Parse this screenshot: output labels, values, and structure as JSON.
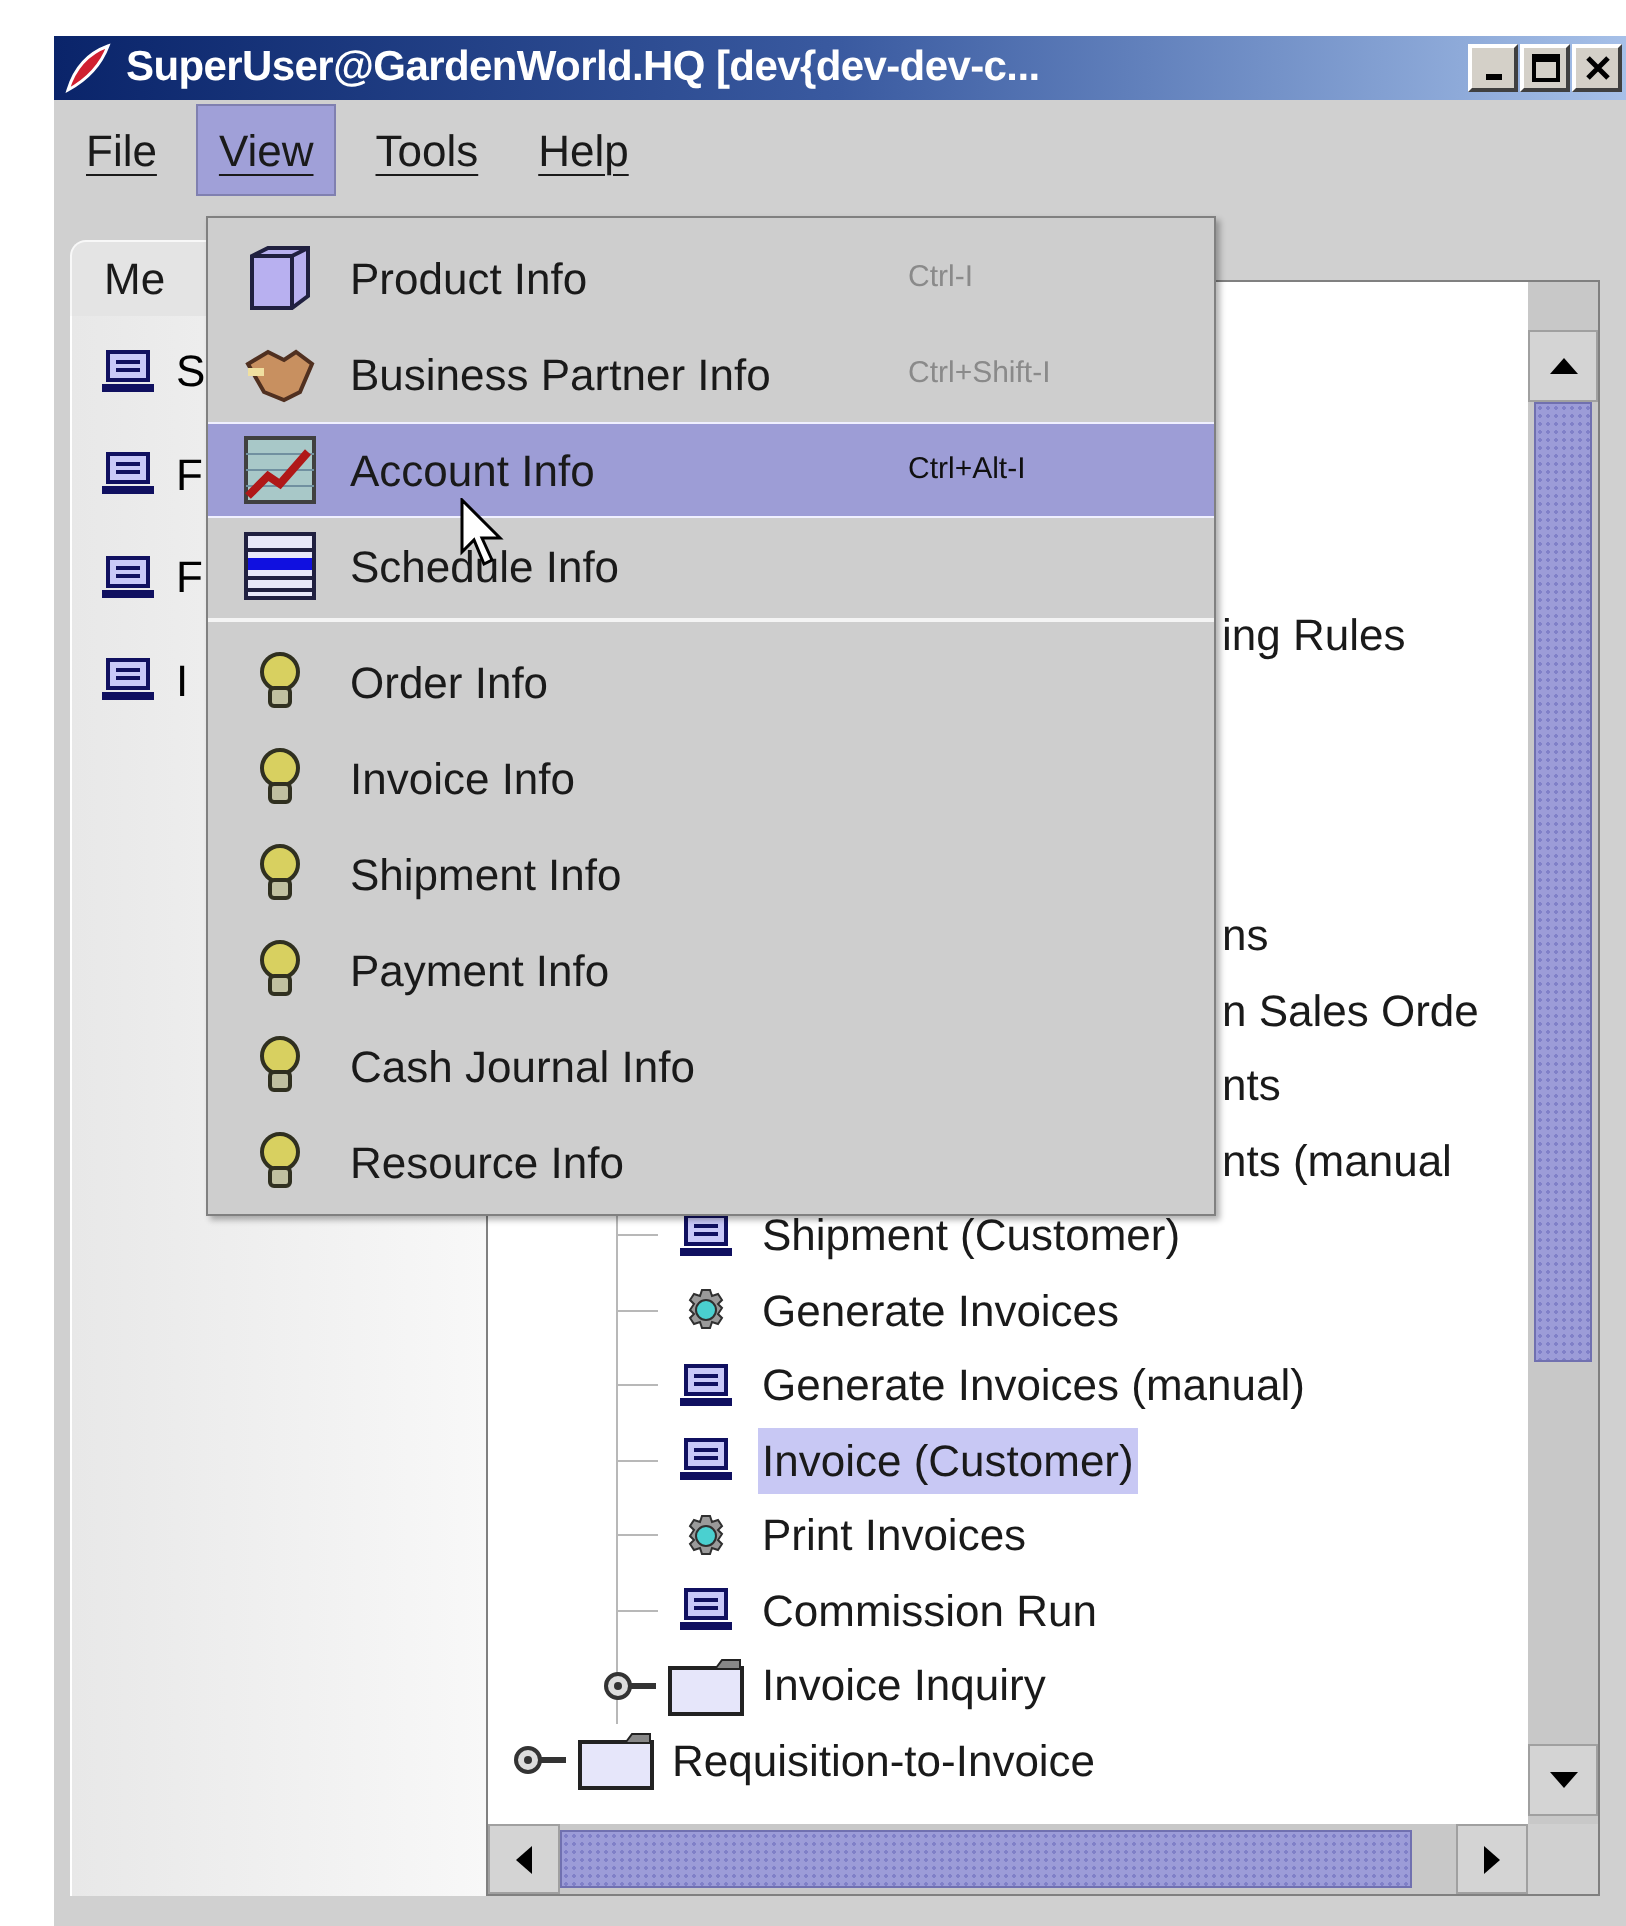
{
  "window": {
    "title": "SuperUser@GardenWorld.HQ [dev{dev-dev-c..."
  },
  "menu_bar": [
    {
      "label": "File",
      "selected": false
    },
    {
      "label": "View",
      "selected": true
    },
    {
      "label": "Tools",
      "selected": false
    },
    {
      "label": "Help",
      "selected": false
    }
  ],
  "tabs": [
    {
      "label": "Me",
      "selected": true
    }
  ],
  "left_list": [
    {
      "label": "S"
    },
    {
      "label": "F"
    },
    {
      "label": "F"
    },
    {
      "label": "I"
    }
  ],
  "view_menu": {
    "sections": [
      [
        {
          "kind": "product",
          "label": "Product Info",
          "shortcut": "Ctrl-I",
          "selected": false
        },
        {
          "kind": "partner",
          "label": "Business Partner Info",
          "shortcut": "Ctrl+Shift-I",
          "selected": false
        },
        {
          "kind": "account",
          "label": "Account Info",
          "shortcut": "Ctrl+Alt-I",
          "selected": true
        },
        {
          "kind": "schedule",
          "label": "Schedule Info",
          "selected": false
        }
      ],
      [
        {
          "kind": "bulb",
          "label": "Order Info",
          "selected": false
        },
        {
          "kind": "bulb",
          "label": "Invoice Info",
          "selected": false
        },
        {
          "kind": "bulb",
          "label": "Shipment Info",
          "selected": false
        },
        {
          "kind": "bulb",
          "label": "Payment Info",
          "selected": false
        },
        {
          "kind": "bulb",
          "label": "Cash Journal Info",
          "selected": false
        },
        {
          "kind": "bulb",
          "label": "Resource Info",
          "selected": false
        }
      ]
    ]
  },
  "tree": {
    "covered_rows": [
      "ing Rules",
      "ns",
      "n Sales Orde",
      "nts",
      "nts (manual"
    ],
    "nodes": [
      {
        "kind": "group",
        "children": [
          {
            "kind": "window",
            "label": "Shipment (Customer)",
            "selected": false
          },
          {
            "kind": "process",
            "label": "Generate Invoices",
            "selected": false
          },
          {
            "kind": "window",
            "label": "Generate Invoices (manual)",
            "selected": false
          },
          {
            "kind": "window",
            "label": "Invoice (Customer)",
            "selected": true
          },
          {
            "kind": "process",
            "label": "Print Invoices",
            "selected": false
          },
          {
            "kind": "window",
            "label": "Commission Run",
            "selected": false
          },
          {
            "kind": "folder",
            "label": "Invoice Inquiry",
            "expanded": false,
            "selected": false
          }
        ]
      },
      {
        "kind": "folder",
        "label": "Requisition-to-Invoice",
        "expanded": false,
        "selected": false
      }
    ]
  }
}
